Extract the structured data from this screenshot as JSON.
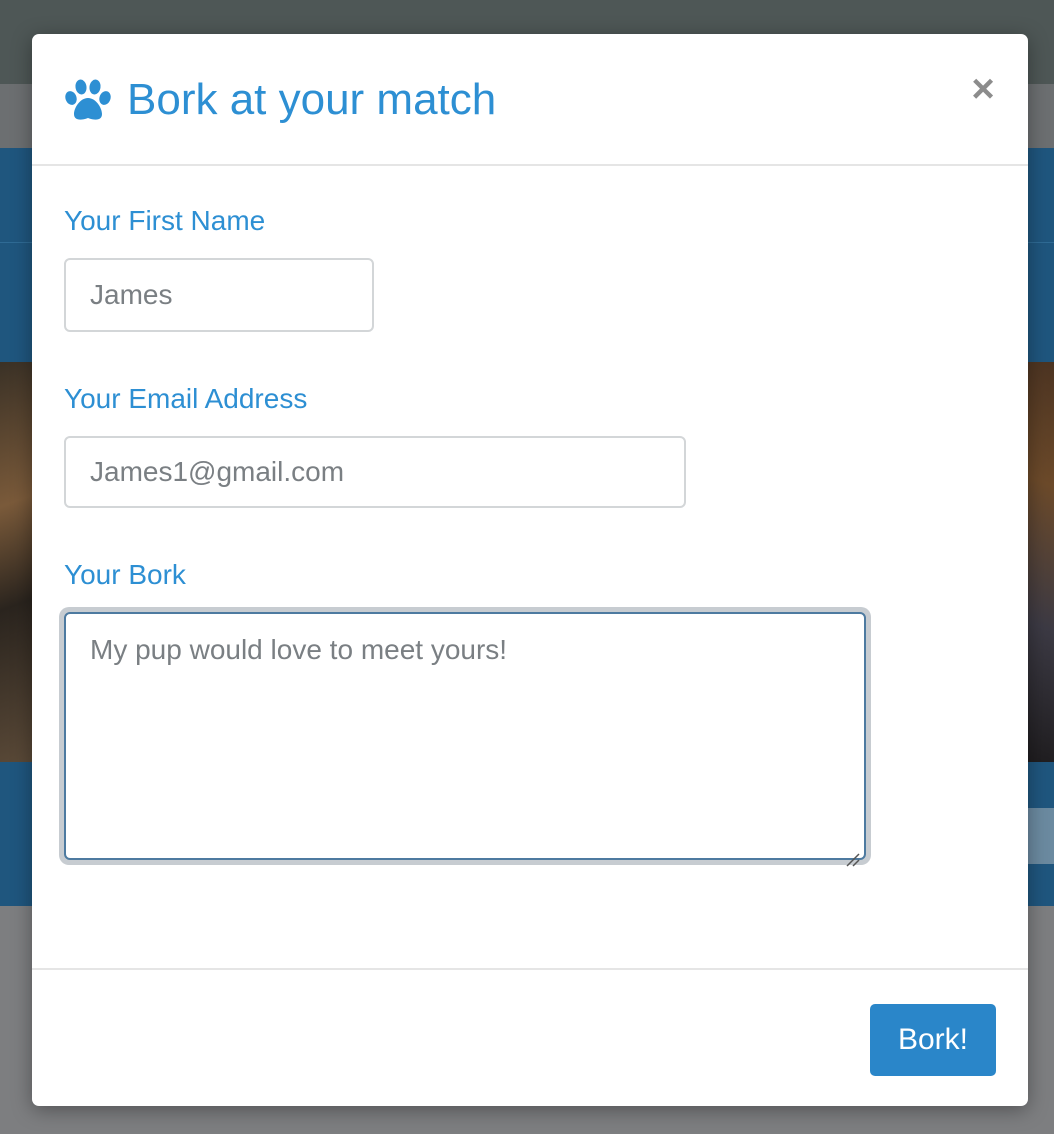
{
  "modal": {
    "title": "Bork at your match",
    "icon": "paw-icon",
    "close_label": "×"
  },
  "form": {
    "first_name": {
      "label": "Your First Name",
      "value": "James"
    },
    "email": {
      "label": "Your Email Address",
      "value": "James1@gmail.com"
    },
    "bork": {
      "label": "Your Bork",
      "value": "My pup would love to meet yours!"
    }
  },
  "footer": {
    "submit_label": "Bork!"
  },
  "colors": {
    "accent": "#2d8fd3",
    "button": "#2a86c9",
    "overlay_navbar": "#4e5756",
    "overlay_blue": "#1f567e"
  }
}
